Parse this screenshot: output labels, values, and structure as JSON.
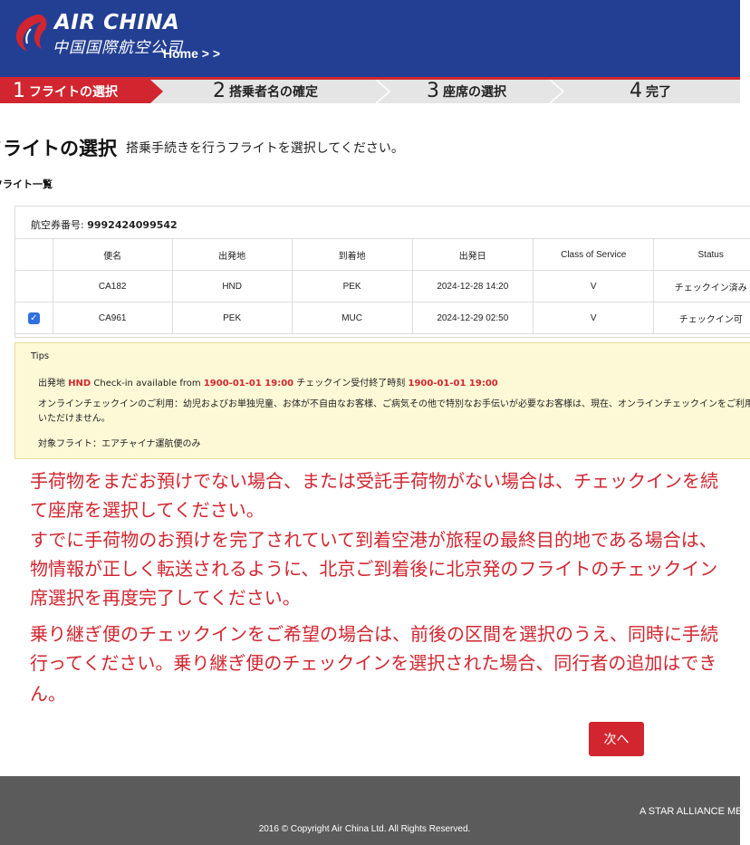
{
  "header": {
    "brand_en": "AIR CHINA",
    "brand_cn": "中国国際航空公司",
    "breadcrumb": "Home > >"
  },
  "steps": [
    {
      "num": "1",
      "label": "フライトの選択",
      "active": true
    },
    {
      "num": "2",
      "label": "搭乗者名の確定",
      "active": false
    },
    {
      "num": "3",
      "label": "座席の選択",
      "active": false
    },
    {
      "num": "4",
      "label": "完了",
      "active": false
    }
  ],
  "page": {
    "title": "フライトの選択",
    "subtitle": "搭乗手続きを行うフライトを選択してください。",
    "section_label": "フライト一覧"
  },
  "ticket": {
    "label": "航空券番号: ",
    "number": "9992424099542"
  },
  "table": {
    "headers": [
      "便名",
      "出発地",
      "到着地",
      "出発日",
      "Class of Service",
      "Status"
    ],
    "rows": [
      {
        "checked": false,
        "flight": "CA182",
        "from": "HND",
        "to": "PEK",
        "date": "2024-12-28 14:20",
        "class": "V",
        "status": "チェックイン済み"
      },
      {
        "checked": true,
        "flight": "CA961",
        "from": "PEK",
        "to": "MUC",
        "date": "2024-12-29 02:50",
        "class": "V",
        "status": "チェックイン可"
      }
    ]
  },
  "tips": {
    "title": "Tips",
    "line1_pre": "出発地 ",
    "line1_airport": "HND",
    "line1_mid": " Check-in available from ",
    "line1_time1": "1900-01-01 19:00",
    "line1_mid2": " チェックイン受付終了時刻 ",
    "line1_time2": "1900-01-01 19:00",
    "line2": "オンラインチェックインのご利用：幼児およびお単独児童、お体が不自由なお客様、ご病気その他で特別なお手伝いが必要なお客様は、現在、オンラインチェックインをご利用いただけません。",
    "line3": "対象フライト：エアチャイナ運航便のみ"
  },
  "notice": {
    "lines": [
      "手荷物をまだお預けでない場合、または受託手荷物がない場合は、チェックインを続",
      "て座席を選択してください。",
      "すでに手荷物のお預けを完了されていて到着空港が旅程の最終目的地である場合は、",
      "物情報が正しく転送されるように、北京ご到着後に北京発のフライトのチェックイン",
      "席選択を再度完了してください。",
      "乗り継ぎ便のチェックインをご希望の場合は、前後の区間を選択のうえ、同時に手続",
      "行ってください。乗り継ぎ便のチェックインを選択された場合、同行者の追加はでき",
      "ん。"
    ]
  },
  "next_button": "次へ",
  "footer": {
    "star_alliance": "A STAR ALLIANCE ME",
    "copyright": "2016 © Copyright Air China Ltd. All Rights Reserved."
  },
  "colors": {
    "header_blue": "#233f93",
    "accent_red": "#d12630",
    "tips_bg": "#fdf9d6",
    "footer_gray": "#5b5b5b"
  }
}
